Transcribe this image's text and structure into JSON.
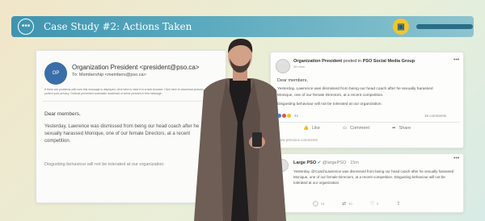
{
  "header": {
    "title": "Case Study #2: Actions Taken",
    "menu_icon": "ellipsis-circle-icon",
    "badge_icon": "chat-badge-icon",
    "accent": "#3f94b0",
    "badge_color": "#f2c530"
  },
  "email": {
    "avatar_text": "OP",
    "from": "Organization President <president@pso.ca>",
    "to": "To: Membership <members@pso.ca>",
    "notice": "If there are problems with how this message is displayed, click here to view it in a web browser. Click here to download pictures. To help protect your privacy, Outlook prevented automatic download of some pictures in this message.",
    "greeting": "Dear members,",
    "body": "Yesterday, Lawrence was dismissed from being our head coach after he sexually harassed Monique, one of our female Directors, at a recent competition.",
    "closing": "Disgusting behaviour will not be tolerated at our organization."
  },
  "post": {
    "author": "Organization President",
    "posted_in": "posted in",
    "group": "PSO Social Media Group",
    "time": "48 mins",
    "greeting": "Dear members,",
    "body": "Yesterday, Lawrence was dismissed from being our head coach after he sexually harassed Monique, one of our female Directors, at a recent competition.",
    "closing": "Disgusting behaviour will not be tolerated at our organization.",
    "reaction_count": "42",
    "comment_count": "16 comments",
    "like_label": "Like",
    "comment_label": "Comment",
    "share_label": "Share",
    "previous_comments": "View previous comments"
  },
  "tweet": {
    "name": "Large PSO",
    "handle": "@largePSO · 15m",
    "body": "Yesterday, @CoachLawrence was dismissed from being our head coach after he sexually harassed Monique, one of our female Directors, at a recent competition. Disgusting behaviour will not be tolerated at our organization.",
    "reply_count": "15",
    "retweet_count": "10",
    "like_count": "9"
  }
}
